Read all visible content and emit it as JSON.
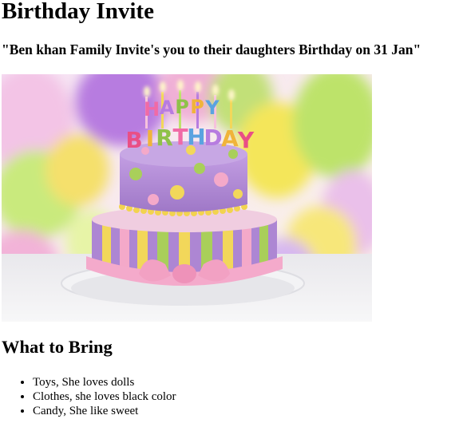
{
  "page": {
    "title": "Birthday Invite",
    "invitation": "\"Ben khan Family Invite's you to their daughters Birthday on 31 Jan\""
  },
  "image": {
    "subject": "birthday-cake-photo",
    "cake_text": "HAPPY BIRTHDAY",
    "colors": {
      "cake_purple": "#b48ad6",
      "cake_yellow": "#f2d75a",
      "cake_green": "#a9cf5a",
      "ribbon_pink": "#f4aacb",
      "background": "#f7e9f4"
    }
  },
  "bring": {
    "heading": "What to Bring",
    "items": [
      "Toys, She loves dolls",
      "Clothes, she loves black color",
      "Candy, She like sweet"
    ]
  }
}
